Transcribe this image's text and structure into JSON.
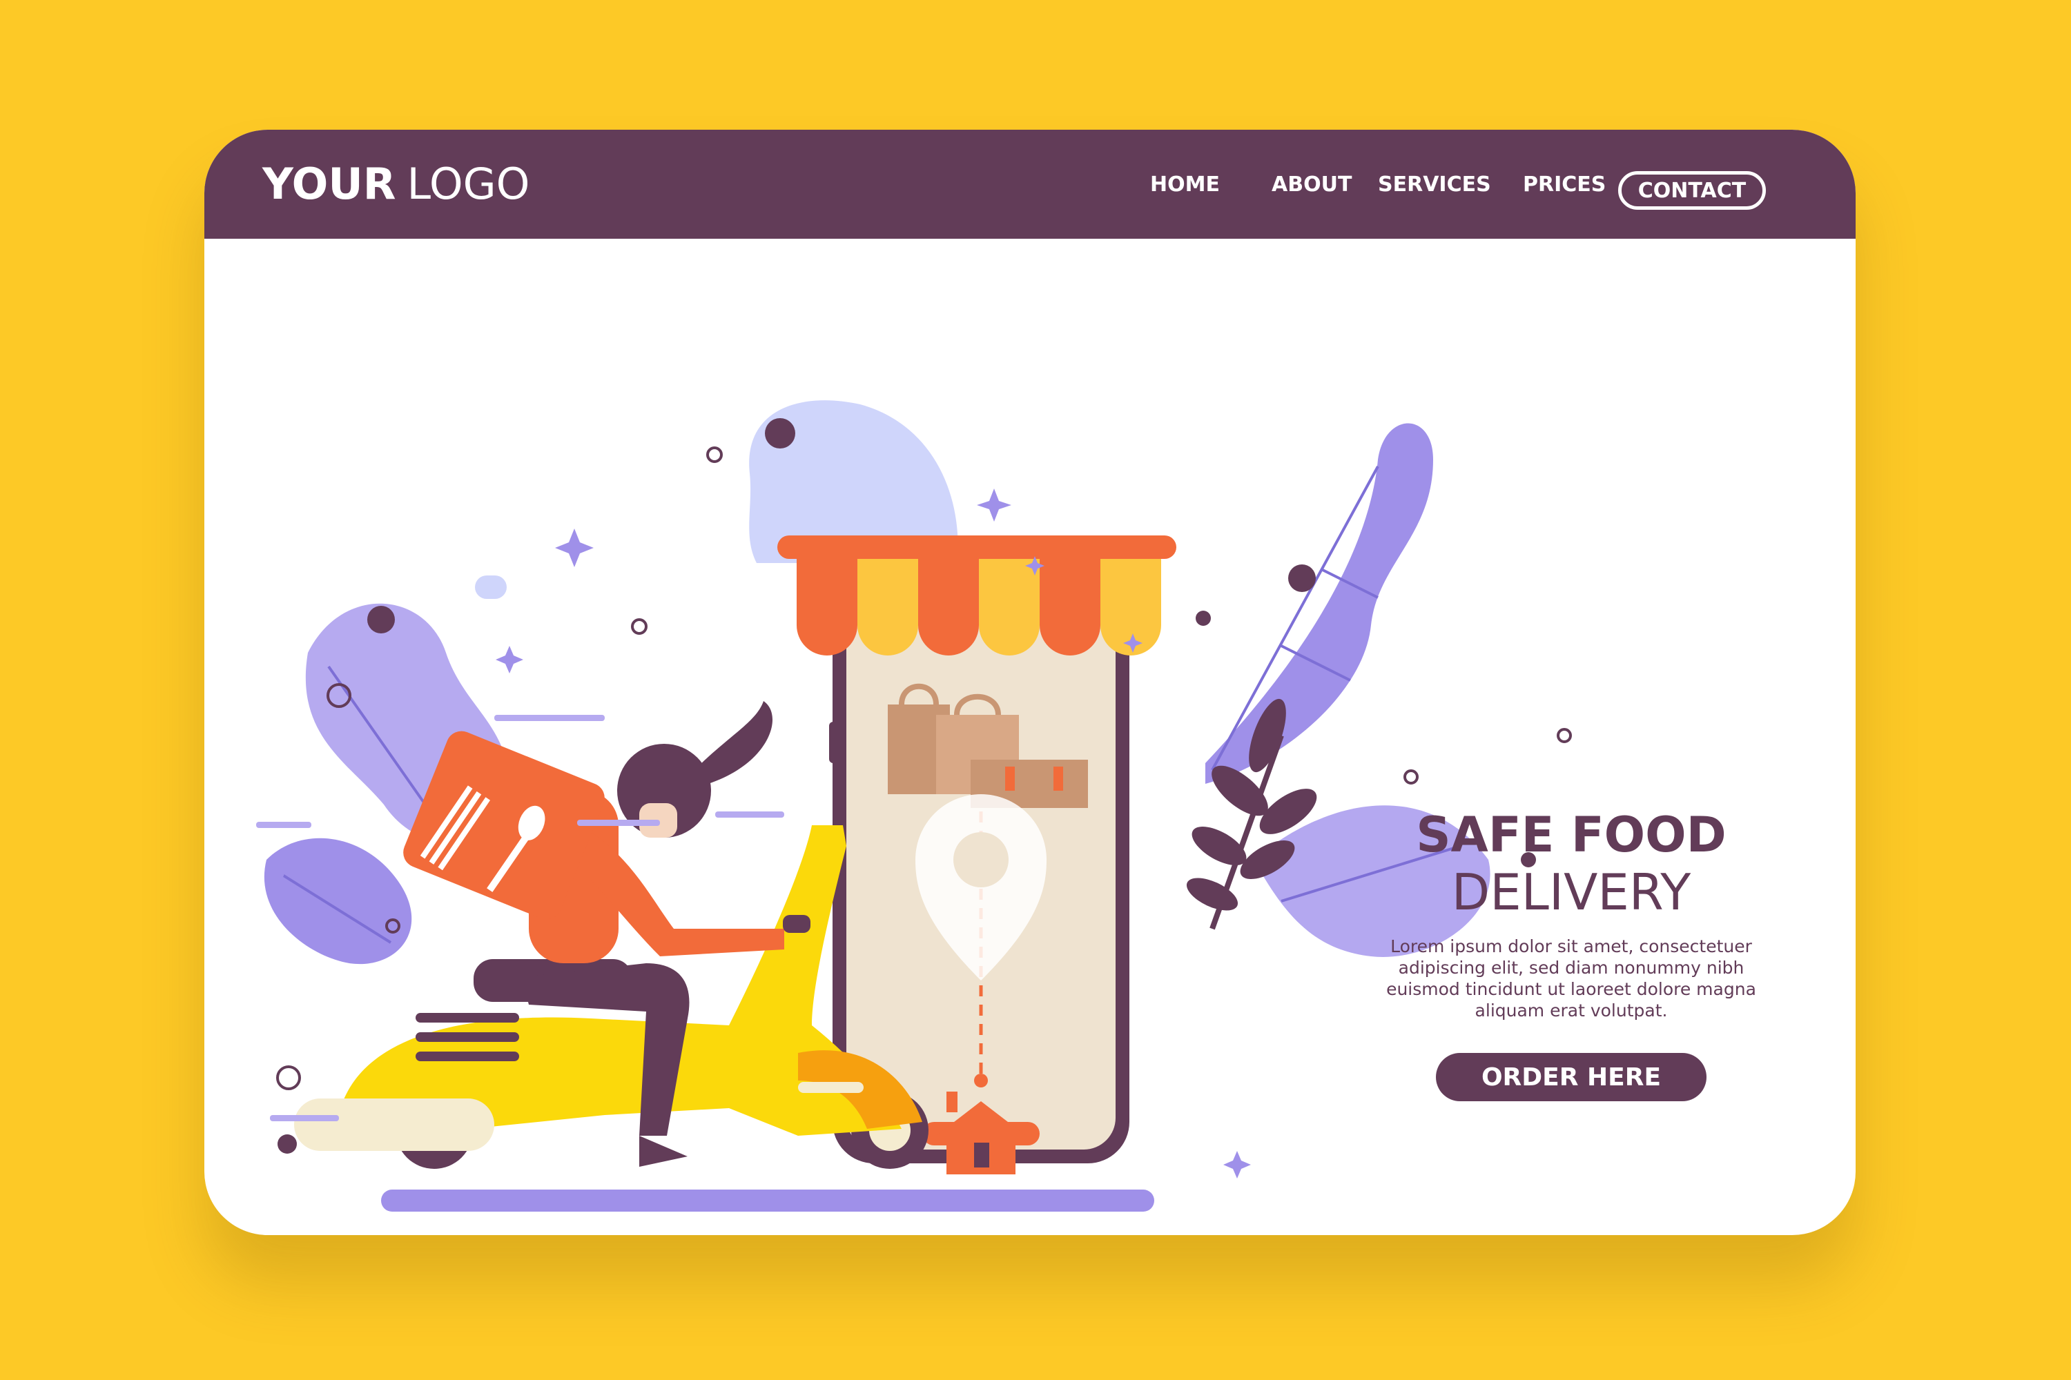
{
  "brand": {
    "logo_bold": "YOUR",
    "logo_thin": "LOGO"
  },
  "nav": {
    "items": [
      {
        "label": "HOME"
      },
      {
        "label": "ABOUT"
      },
      {
        "label": "SERVICES"
      },
      {
        "label": "PRICES"
      }
    ],
    "contact_label": "CONTACT"
  },
  "hero": {
    "title": "SAFE FOOD",
    "subtitle": "DELIVERY",
    "body": "Lorem ipsum dolor sit amet, consectetuer adipiscing elit, sed diam nonummy nibh euismod tincidunt ut laoreet dolore magna aliquam erat volutpat.",
    "cta_label": "ORDER HERE"
  },
  "colors": {
    "page_background": "#fdc926",
    "nav_background": "#623c58",
    "accent_orange": "#f26b3a",
    "accent_purple": "#9f90e9",
    "scooter_yellow": "#fbd90b"
  },
  "illustration_icons": [
    "delivery-rider-icon",
    "scooter-icon",
    "food-box-icon",
    "smartphone-icon",
    "shop-awning-icon",
    "shopping-bags-icon",
    "location-pin-icon",
    "house-icon",
    "leaf-icon",
    "sparkle-icon"
  ]
}
